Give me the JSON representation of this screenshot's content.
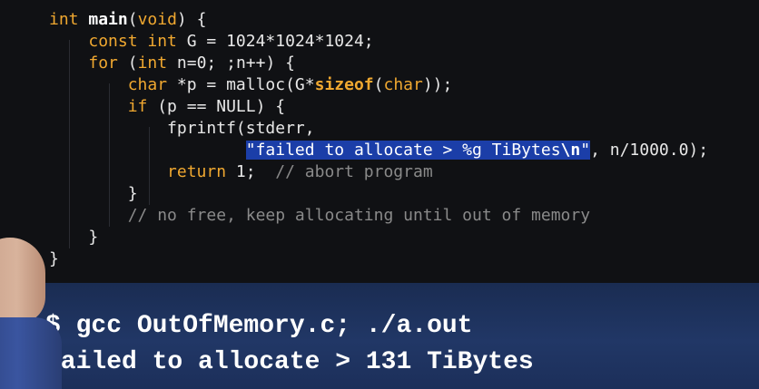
{
  "code_lines": [
    {
      "tokens": [
        {
          "t": "int ",
          "c": "kw"
        },
        {
          "t": "main",
          "c": "fn"
        },
        {
          "t": "(",
          "c": ""
        },
        {
          "t": "void",
          "c": "kw"
        },
        {
          "t": ") {",
          "c": ""
        }
      ]
    },
    {
      "tokens": [
        {
          "t": "    ",
          "c": ""
        },
        {
          "t": "const int ",
          "c": "kw"
        },
        {
          "t": "G = 1024*1024*1024;",
          "c": ""
        }
      ]
    },
    {
      "tokens": [
        {
          "t": "    ",
          "c": ""
        },
        {
          "t": "for ",
          "c": "kw"
        },
        {
          "t": "(",
          "c": ""
        },
        {
          "t": "int ",
          "c": "kw"
        },
        {
          "t": "n=0; ;n++) {",
          "c": ""
        }
      ]
    },
    {
      "tokens": [
        {
          "t": "        ",
          "c": ""
        },
        {
          "t": "char ",
          "c": "kw"
        },
        {
          "t": "*p = malloc(G*",
          "c": ""
        },
        {
          "t": "sizeof",
          "c": "kwb"
        },
        {
          "t": "(",
          "c": ""
        },
        {
          "t": "char",
          "c": "kw"
        },
        {
          "t": "));",
          "c": ""
        }
      ]
    },
    {
      "tokens": [
        {
          "t": "        ",
          "c": ""
        },
        {
          "t": "if ",
          "c": "kw"
        },
        {
          "t": "(p == NULL) {",
          "c": ""
        }
      ]
    },
    {
      "tokens": [
        {
          "t": "            ",
          "c": ""
        },
        {
          "t": "fprintf(stderr,",
          "c": ""
        }
      ]
    },
    {
      "tokens": [
        {
          "t": "                    ",
          "c": ""
        },
        {
          "t": "\"failed to allocate > %g TiBytes",
          "c": "hl"
        },
        {
          "t": "\\n",
          "c": "hl bold"
        },
        {
          "t": "\"",
          "c": "hl"
        },
        {
          "t": ", n/1000.0);",
          "c": ""
        }
      ]
    },
    {
      "tokens": [
        {
          "t": "            ",
          "c": ""
        },
        {
          "t": "return ",
          "c": "kw"
        },
        {
          "t": "1;  ",
          "c": ""
        },
        {
          "t": "// abort program",
          "c": "cm"
        }
      ]
    },
    {
      "tokens": [
        {
          "t": "        }",
          "c": ""
        }
      ]
    },
    {
      "tokens": [
        {
          "t": "        ",
          "c": ""
        },
        {
          "t": "// no free, keep allocating until out of memory",
          "c": "cm"
        }
      ]
    },
    {
      "tokens": [
        {
          "t": "    }",
          "c": ""
        }
      ]
    },
    {
      "tokens": [
        {
          "t": "}",
          "c": ""
        }
      ]
    }
  ],
  "terminal": {
    "command": "$ gcc OutOfMemory.c; ./a.out",
    "output": "Failed to allocate > 131 TiBytes"
  }
}
